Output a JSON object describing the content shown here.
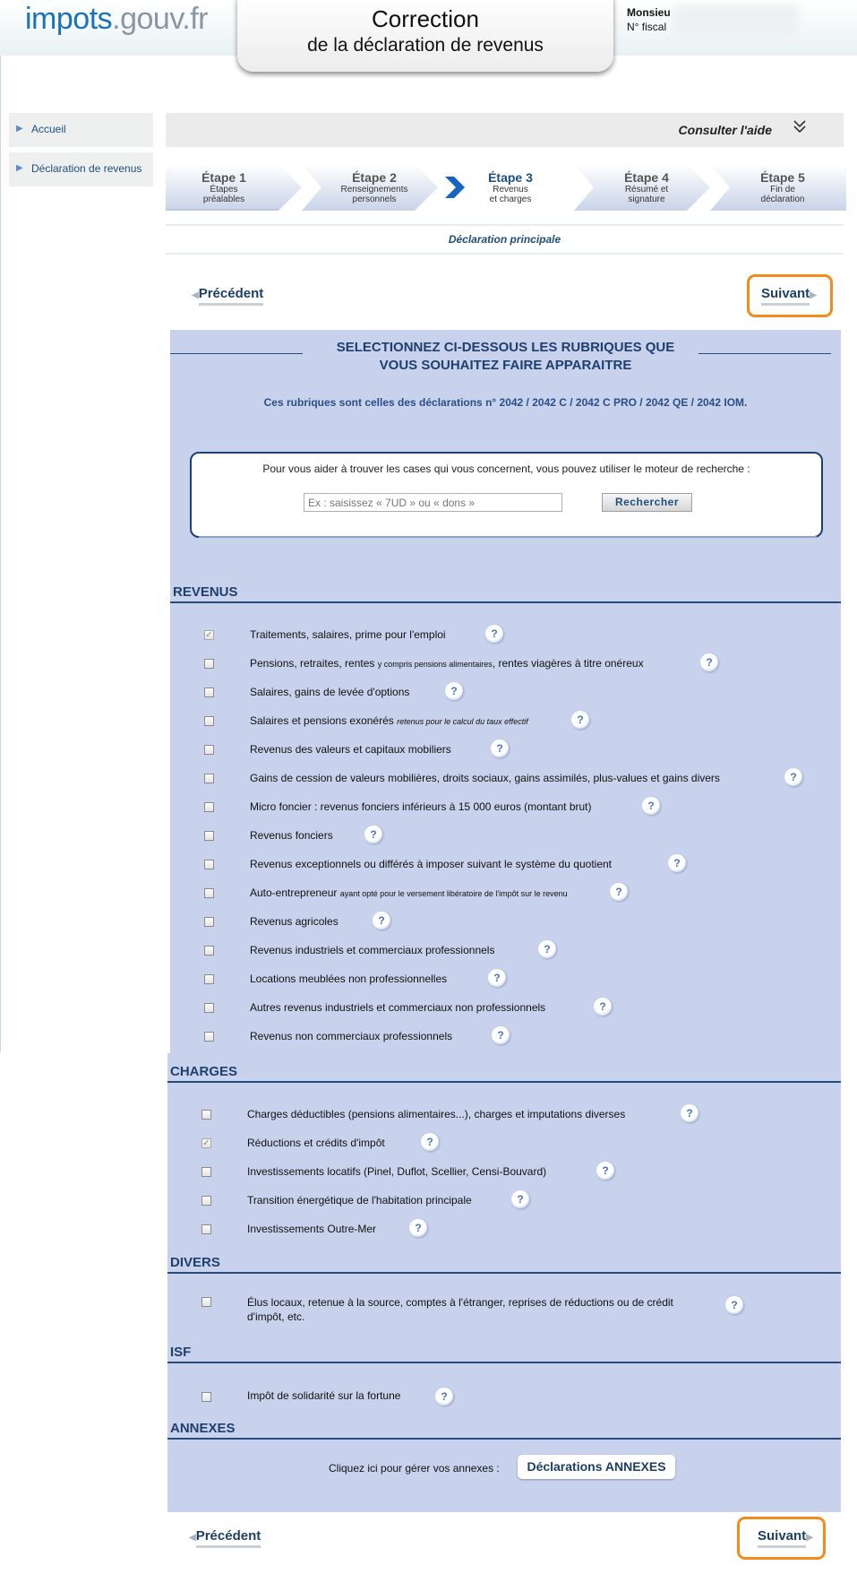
{
  "header": {
    "logo_main": "impots",
    "logo_gov": ".gouv.fr",
    "title_line1": "Correction",
    "title_line2": "de la déclaration de revenus",
    "user_name": "Monsieu",
    "user_fiscal": "N° fiscal"
  },
  "sidebar": {
    "items": [
      {
        "label": "Accueil"
      },
      {
        "label": "Déclaration de revenus"
      }
    ]
  },
  "help": {
    "label": "Consulter l'aide"
  },
  "steps": [
    {
      "num": "Étape 1",
      "line1": "Étapes",
      "line2": "préalables",
      "active": false
    },
    {
      "num": "Étape 2",
      "line1": "Renseignements",
      "line2": "personnels",
      "active": false
    },
    {
      "num": "Étape 3",
      "line1": "Revenus",
      "line2": "et charges",
      "active": true
    },
    {
      "num": "Étape 4",
      "line1": "Résumé et",
      "line2": "signature",
      "active": false
    },
    {
      "num": "Étape 5",
      "line1": "Fin de",
      "line2": "déclaration",
      "active": false
    }
  ],
  "declaration_label": "Déclaration principale",
  "nav": {
    "prev": "Précédent",
    "next": "Suivant"
  },
  "headline_line1": "SELECTIONNEZ CI-DESSOUS LES RUBRIQUES QUE",
  "headline_line2": "VOUS SOUHAITEZ FAIRE APPARAITRE",
  "subheadline": "Ces rubriques sont celles des déclarations n° 2042 / 2042 C / 2042 C PRO / 2042 QE / 2042 IOM.",
  "search": {
    "text": "Pour vous aider à trouver les cases qui vous concernent, vous pouvez utiliser le moteur de recherche :",
    "placeholder": "Ex : saisissez « 7UD » ou « dons »",
    "button": "Rechercher"
  },
  "sections": {
    "revenus": {
      "title": "REVENUS",
      "items": [
        {
          "text": "Traitements, salaires, prime pour l'emploi",
          "checked": true
        },
        {
          "text": "Pensions, retraites, rentes",
          "small": "y compris pensions alimentaires",
          "after": ", rentes viagères à titre onéreux",
          "checked": false
        },
        {
          "text": "Salaires, gains de levée d'options",
          "checked": false
        },
        {
          "text": "Salaires et pensions exonérés",
          "smallit": "retenus pour le calcul du taux effectif",
          "checked": false
        },
        {
          "text": "Revenus des valeurs et capitaux mobiliers",
          "checked": false
        },
        {
          "text": "Gains de cession de valeurs mobilières, droits sociaux, gains assimilés, plus-values et gains divers",
          "checked": false
        },
        {
          "text": "Micro foncier : revenus fonciers inférieurs à 15 000 euros (montant brut)",
          "checked": false
        },
        {
          "text": "Revenus fonciers",
          "checked": false
        },
        {
          "text": "Revenus exceptionnels ou différés à imposer suivant le système du quotient",
          "checked": false
        },
        {
          "text": "Auto-entrepreneur",
          "small": "ayant opté pour le versement libératoire de l'impôt sur le revenu",
          "checked": false
        },
        {
          "text": "Revenus agricoles",
          "checked": false
        },
        {
          "text": "Revenus industriels et commerciaux professionnels",
          "checked": false
        },
        {
          "text": "Locations meublées non professionnelles",
          "checked": false
        },
        {
          "text": "Autres revenus industriels et commerciaux non professionnels",
          "checked": false
        },
        {
          "text": "Revenus non commerciaux professionnels",
          "checked": false
        }
      ]
    },
    "charges": {
      "title": "CHARGES",
      "items": [
        {
          "text": "Charges déductibles (pensions alimentaires...), charges et imputations diverses",
          "checked": false
        },
        {
          "text": "Réductions et crédits d'impôt",
          "checked": true
        },
        {
          "text": "Investissements locatifs (Pinel, Duflot, Scellier, Censi-Bouvard)",
          "checked": false
        },
        {
          "text": "Transition énergétique de l'habitation principale",
          "checked": false
        },
        {
          "text": "Investissements Outre-Mer",
          "checked": false
        }
      ]
    },
    "divers": {
      "title": "DIVERS",
      "items": [
        {
          "text": "Élus locaux, retenue à la source, comptes à l'étranger, reprises de réductions ou de crédit",
          "text2": "d'impôt, etc.",
          "checked": false
        }
      ]
    },
    "isf": {
      "title": "ISF",
      "items": [
        {
          "text": "Impôt de solidarité sur la fortune",
          "checked": false
        }
      ]
    },
    "annexes": {
      "title": "ANNEXES",
      "text": "Cliquez ici pour gérer vos annexes :",
      "button": "Déclarations ANNEXES"
    }
  },
  "colors": {
    "panel": "#c8d2ec",
    "heading": "#1f3f6e",
    "highlight": "#f28c1c",
    "step_active_chevron": "#1565c0"
  },
  "icons": {
    "help": "help-question-icon",
    "chevron": "double-chevron-down-icon",
    "sidebar_arrow": "triangle-right-icon"
  }
}
